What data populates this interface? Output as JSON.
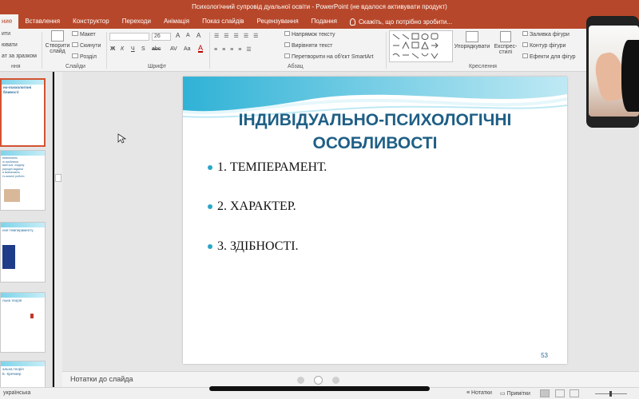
{
  "window": {
    "title": "Психологічний супровід дуальної освіти - PowerPoint (не вдалося активувати продукт)"
  },
  "ribbon_tabs": {
    "items": [
      {
        "label": "ние",
        "active": true
      },
      {
        "label": "Вставлення",
        "active": false
      },
      {
        "label": "Конструктор",
        "active": false
      },
      {
        "label": "Переходи",
        "active": false
      },
      {
        "label": "Анімація",
        "active": false
      },
      {
        "label": "Показ слайдів",
        "active": false
      },
      {
        "label": "Рецензування",
        "active": false
      },
      {
        "label": "Подання",
        "active": false
      }
    ],
    "tell_me": "Скажіть, що потрібно зробити..."
  },
  "ribbon": {
    "clipboard": {
      "item1": "ити",
      "item2": "ювати",
      "item3": "ат за зразком",
      "label": "ння"
    },
    "slides": {
      "new_slide_line1": "Створити",
      "new_slide_line2": "слайд",
      "layout": "Макет",
      "reset": "Скинути",
      "section": "Розділ",
      "label": "Слайди"
    },
    "font": {
      "size": "26",
      "bold": "Ж",
      "italic": "К",
      "underline": "Ч",
      "shadow": "S",
      "strike": "abc",
      "label": "Шрифт"
    },
    "paragraph": {
      "text_direction": "Напрямок тексту",
      "align_text": "Вирівняти текст",
      "convert_smartart": "Перетворити на об'єкт SmartArt",
      "label": "Абзац"
    },
    "drawing": {
      "arrange": "Упорядкувати",
      "quick_styles_line1": "Експрес-",
      "quick_styles_line2": "стилі",
      "shape_fill": "Заливка фігури",
      "shape_outline": "Контур фігури",
      "shape_effects": "Ефекти для фігур",
      "label": "Креслення"
    }
  },
  "thumbnails": [
    {
      "text": "но-психологічні\nбливості",
      "selected": true
    },
    {
      "text": "визначають\nні проблеми\nмається, людину\nриродні задатки\nи визначають\nть якісної роботи",
      "selected": false
    },
    {
      "text": "ння темпераменту",
      "selected": false
    },
    {
      "text": "льна теорія",
      "selected": false
    },
    {
      "text": "альна теорія\nЕ. Кречмер",
      "selected": false
    }
  ],
  "slide": {
    "title_line1": "ІНДИВІДУАЛЬНО-ПСИХОЛОГІЧНІ",
    "title_line2": "ОСОБЛИВОСТІ",
    "bullets": [
      "1. ТЕМПЕРАМЕНТ.",
      "2. ХАРАКТЕР.",
      "3. ЗДІБНОСТІ."
    ],
    "number": "53",
    "accent_color": "#1f5f86",
    "bullet_color": "#2aa6c9"
  },
  "notes": {
    "placeholder": "Нотатки до слайда"
  },
  "status_bar": {
    "language": "українська",
    "notes": "Нотатки",
    "comments": "Примітки"
  },
  "colors": {
    "ribbon_brand": "#b7472a"
  }
}
